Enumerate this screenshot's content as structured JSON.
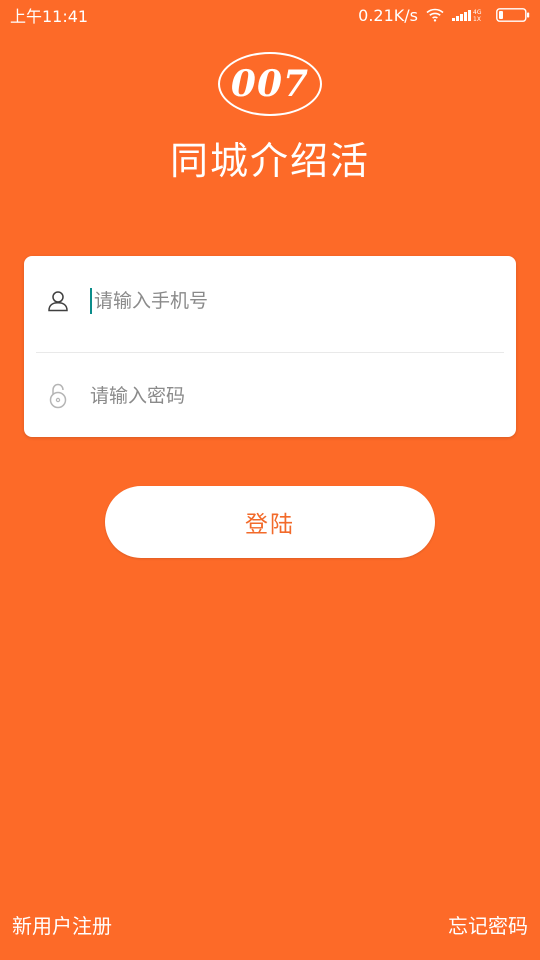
{
  "status_bar": {
    "time": "上午11:41",
    "network_speed": "0.21K/s",
    "network_type_top": "4G",
    "network_type_bottom": "1X",
    "icons": [
      "wifi-icon",
      "signal-icon",
      "battery-icon"
    ]
  },
  "logo": {
    "text": "007"
  },
  "app_name": "同城介绍活",
  "login_form": {
    "phone_placeholder": "请输入手机号",
    "phone_value": "",
    "password_placeholder": "请输入密码",
    "password_value": "",
    "icons": [
      "user-icon",
      "lock-icon"
    ]
  },
  "login_button_label": "登陆",
  "bottom_links": {
    "register": "新用户注册",
    "forgot_password": "忘记密码"
  },
  "colors": {
    "background": "#fd6a28",
    "button_text": "#f26a2a",
    "caret": "#0b8c8a"
  }
}
